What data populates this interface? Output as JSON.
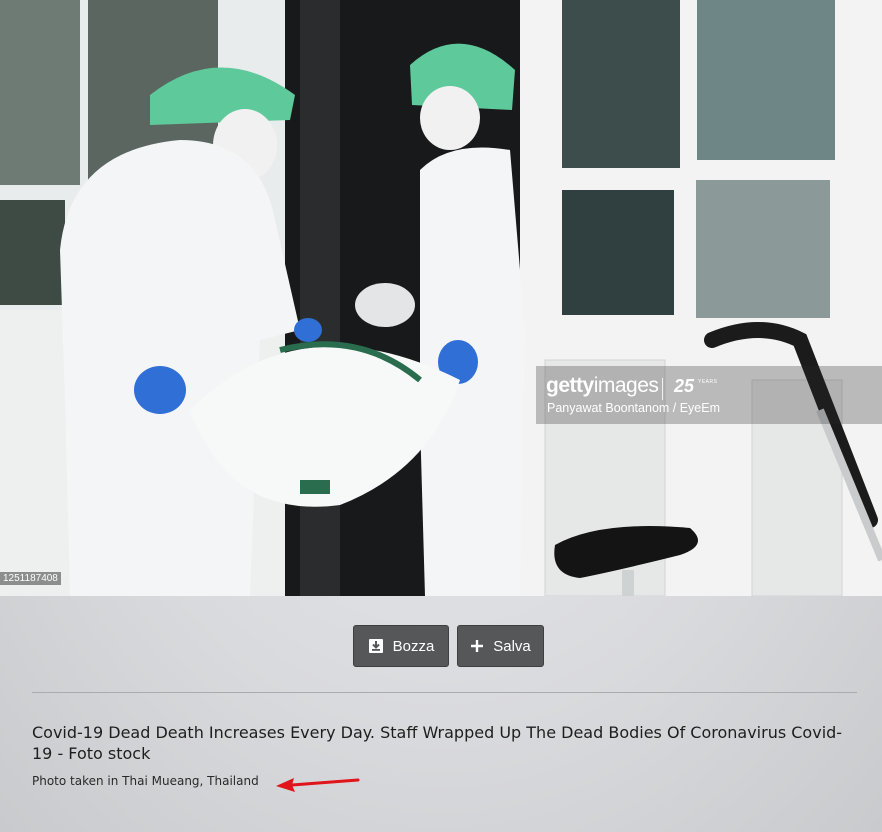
{
  "photo": {
    "watermark_brand_bold": "getty",
    "watermark_brand_light": "images",
    "watermark_anniversary": "25",
    "watermark_anniversary_word": "YEARS",
    "watermark_credit": "Panyawat Boontanom / EyeEm",
    "image_id": "1251187408"
  },
  "actions": {
    "draft_label": "Bozza",
    "save_label": "Salva"
  },
  "icons": {
    "draft": "download-box-icon",
    "save": "plus-icon",
    "annotation": "red-arrow-icon"
  },
  "details": {
    "title": "Covid-19 Dead Death Increases Every Day. Staff Wrapped Up The Dead Bodies Of Coronavirus Covid-19 - Foto stock",
    "caption": "Photo taken in Thai Mueang, Thailand"
  },
  "colors": {
    "button_bg": "#555759",
    "annotation_arrow": "#e0141a"
  }
}
